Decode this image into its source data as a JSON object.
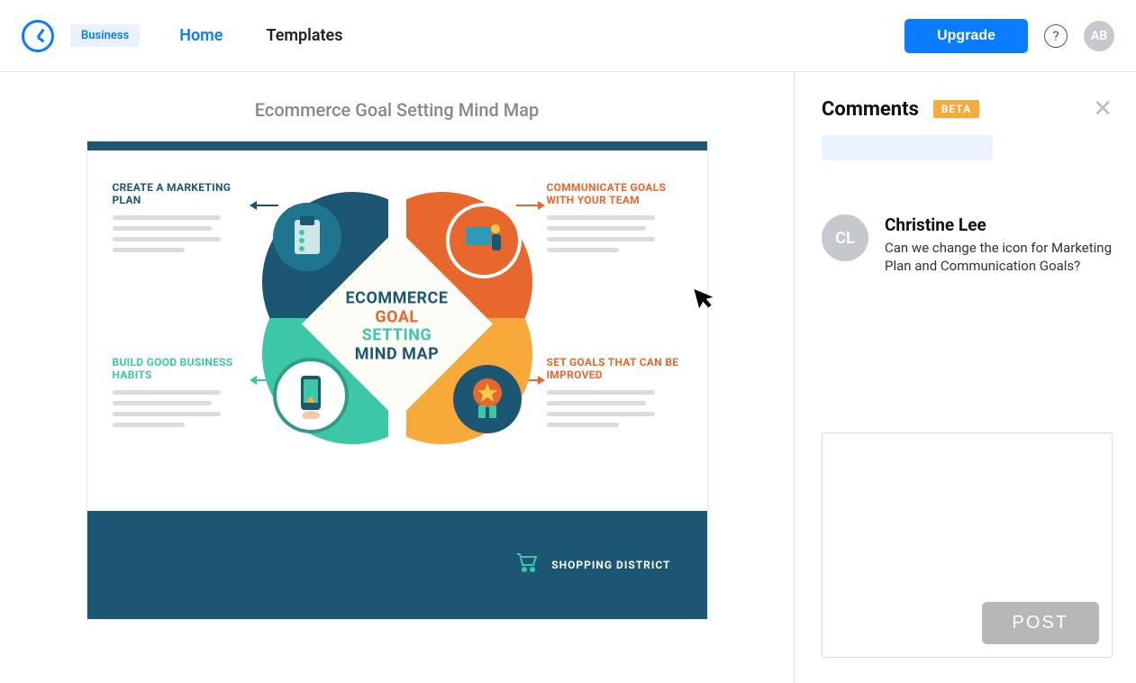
{
  "header": {
    "brand_badge": "Business",
    "nav": {
      "home": "Home",
      "templates": "Templates"
    },
    "upgrade": "Upgrade",
    "help_glyph": "?",
    "avatar_initials": "AB"
  },
  "document": {
    "title": "Ecommerce Goal Setting Mind Map",
    "center": {
      "l1": "ECOMMERCE",
      "l2": "GOAL",
      "l3": "SETTING",
      "l4": "MIND MAP"
    },
    "quadrants": {
      "q1": "CREATE A MARKETING PLAN",
      "q2": "COMMUNICATE GOALS WITH YOUR TEAM",
      "q3": "BUILD GOOD BUSINESS HABITS",
      "q4": "SET GOALS THAT CAN BE IMPROVED"
    },
    "footer_label": "SHOPPING DISTRICT"
  },
  "sidebar": {
    "title": "Comments",
    "badge": "BETA",
    "comment": {
      "initials": "CL",
      "author": "Christine Lee",
      "text": "Can we change the icon for Marketing Plan and Communication Goals?"
    },
    "compose_placeholder": "",
    "post_label": "POST"
  }
}
